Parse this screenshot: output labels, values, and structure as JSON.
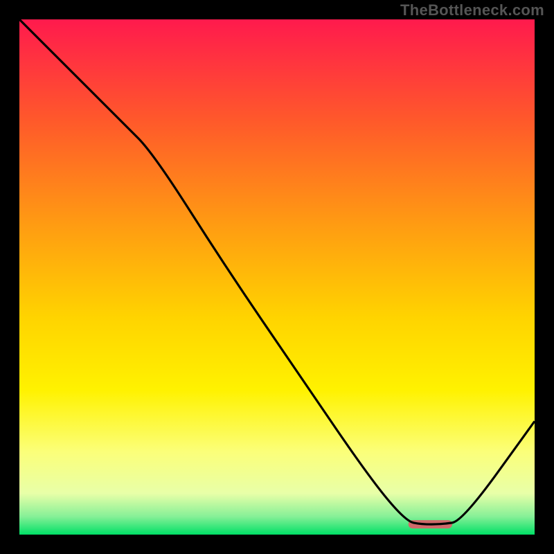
{
  "watermark": "TheBottleneck.com",
  "chart_data": {
    "type": "line",
    "title": "",
    "xlabel": "",
    "ylabel": "",
    "xlim": [
      0,
      100
    ],
    "ylim": [
      0,
      100
    ],
    "grid": false,
    "legend": false,
    "gradient_stops": [
      {
        "offset": 0.0,
        "color": "#ff1a4d"
      },
      {
        "offset": 0.2,
        "color": "#ff5a2a"
      },
      {
        "offset": 0.4,
        "color": "#ff9c12"
      },
      {
        "offset": 0.58,
        "color": "#ffd400"
      },
      {
        "offset": 0.72,
        "color": "#fff200"
      },
      {
        "offset": 0.84,
        "color": "#fbff7a"
      },
      {
        "offset": 0.92,
        "color": "#e8ffa8"
      },
      {
        "offset": 0.965,
        "color": "#86f097"
      },
      {
        "offset": 1.0,
        "color": "#00e066"
      }
    ],
    "series": [
      {
        "name": "bottleneck-curve",
        "x": [
          0,
          10,
          20,
          26,
          40,
          55,
          68,
          75,
          78,
          82,
          86,
          100
        ],
        "y": [
          100,
          90,
          80,
          74,
          52,
          30,
          11,
          2.6,
          2.0,
          2.0,
          2.6,
          22
        ]
      }
    ],
    "marker": {
      "name": "sweet-spot",
      "color": "#d06a6a",
      "x_start": 75.5,
      "x_end": 84,
      "y": 2.0,
      "thickness_pct": 1.6
    }
  }
}
